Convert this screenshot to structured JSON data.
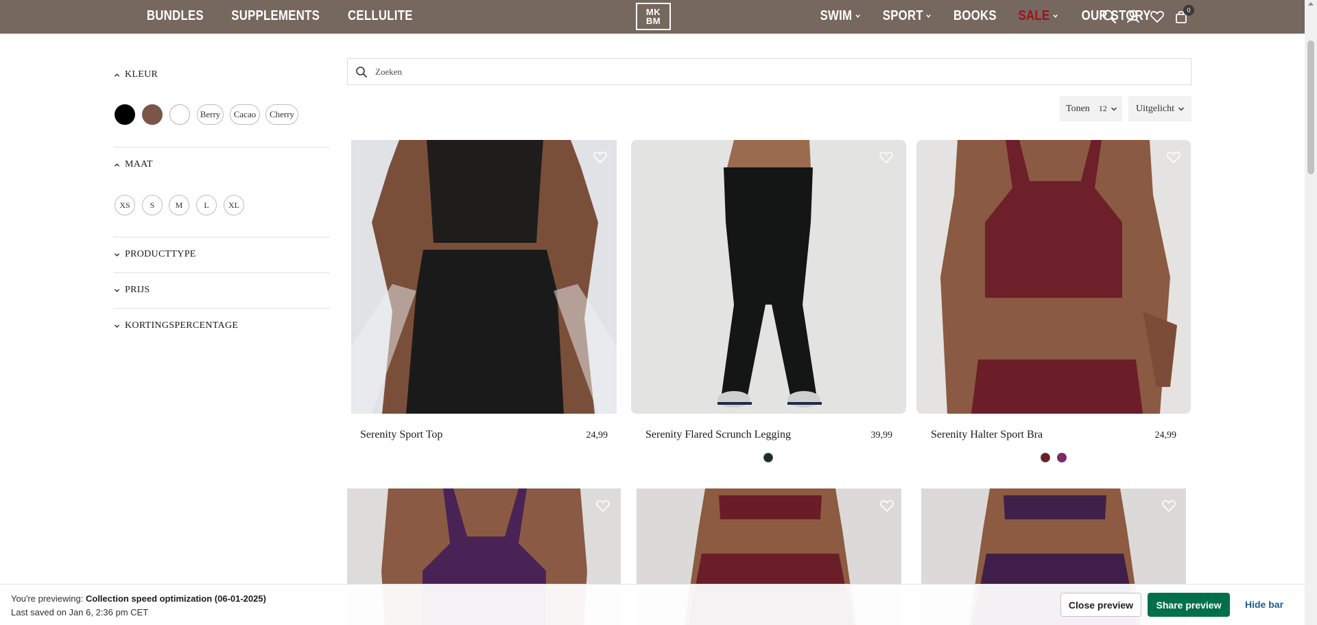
{
  "header": {
    "nav_left": [
      "BUNDLES",
      "SUPPLEMENTS",
      "CELLULITE"
    ],
    "logo_top": "MK",
    "logo_bottom": "BM",
    "nav_right": [
      {
        "label": "SWIM",
        "has_dropdown": true
      },
      {
        "label": "SPORT",
        "has_dropdown": true
      },
      {
        "label": "BOOKS",
        "has_dropdown": false
      },
      {
        "label": "SALE",
        "has_dropdown": true,
        "color": "#9e1218"
      },
      {
        "label": "OUR STORY",
        "has_dropdown": false
      }
    ],
    "icons": [
      "search-icon",
      "account-icon",
      "wishlist-heart-icon",
      "cart-bag-icon"
    ],
    "cart_count": "0",
    "background": "#76675f"
  },
  "filters": {
    "color": {
      "title": "KLEUR",
      "expanded": true,
      "swatches": [
        {
          "name": "Black",
          "hex": "#000000"
        },
        {
          "name": "Brown",
          "hex": "#7a5548"
        },
        {
          "name": "White",
          "hex": "#ffffff"
        }
      ],
      "pills": [
        "Berry",
        "Cacao",
        "Cherry"
      ]
    },
    "size": {
      "title": "MAAT",
      "expanded": true,
      "options": [
        "XS",
        "S",
        "M",
        "L",
        "XL"
      ]
    },
    "collapsed": [
      "PRODUCTTYPE",
      "PRIJS",
      "KORTINGSPERCENTAGE"
    ]
  },
  "search": {
    "placeholder": "Zoeken"
  },
  "sort": {
    "show_label": "Tonen",
    "show_value": "12",
    "sort_value": "Uitgelicht"
  },
  "products": [
    {
      "name": "Serenity Sport Top",
      "price": "24,99",
      "colors": []
    },
    {
      "name": "Serenity Flared Scrunch Legging",
      "price": "39,99",
      "colors": [
        "#15302c"
      ]
    },
    {
      "name": "Serenity Halter Sport Bra",
      "price": "24,99",
      "colors": [
        "#6b1e24",
        "#7a2a68"
      ]
    }
  ],
  "preview_bar": {
    "previewing_label": "You're previewing:",
    "theme_name": "Collection speed optimization (06-01-2025)",
    "last_saved": "Last saved on Jan 6, 2:36 pm CET",
    "close_label": "Close preview",
    "share_label": "Share preview",
    "hide_label": "Hide bar",
    "share_color": "#00704a"
  }
}
